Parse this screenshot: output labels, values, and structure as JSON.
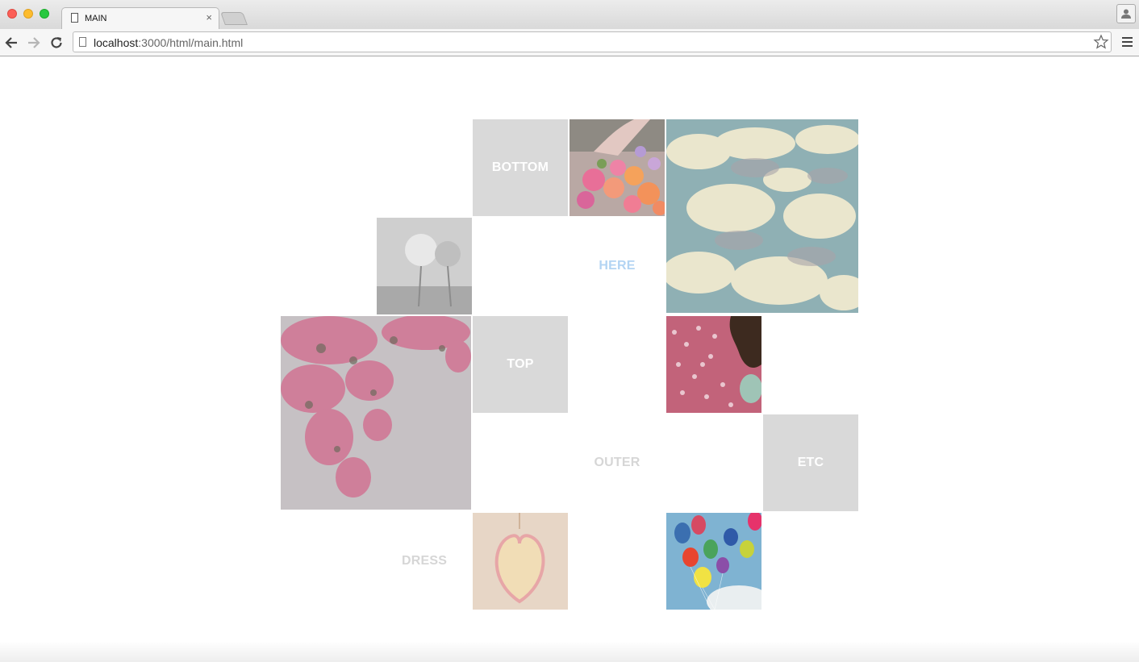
{
  "browser": {
    "tab_title": "MAIN",
    "tab_close": "×",
    "url_host": "localhost",
    "url_path": ":3000/html/main.html"
  },
  "tiles": {
    "bottom": "BOTTOM",
    "here": "HERE",
    "top": "TOP",
    "outer": "OUTER",
    "etc": "ETC",
    "dress": "DRESS"
  },
  "images": {
    "flowers": "hand-with-flowers-photo",
    "clouds": "sky-clouds-photo",
    "dandelion": "dandelion-photo",
    "blossom": "pink-blossom-photo",
    "beads": "hand-beads-photo",
    "cookie": "heart-cookie-photo",
    "balloons": "balloons-sky-photo"
  },
  "colors": {
    "tile_gray": "#d9d9d9",
    "label_blue": "#b3d4f3",
    "label_gray": "#d6d6d6"
  }
}
